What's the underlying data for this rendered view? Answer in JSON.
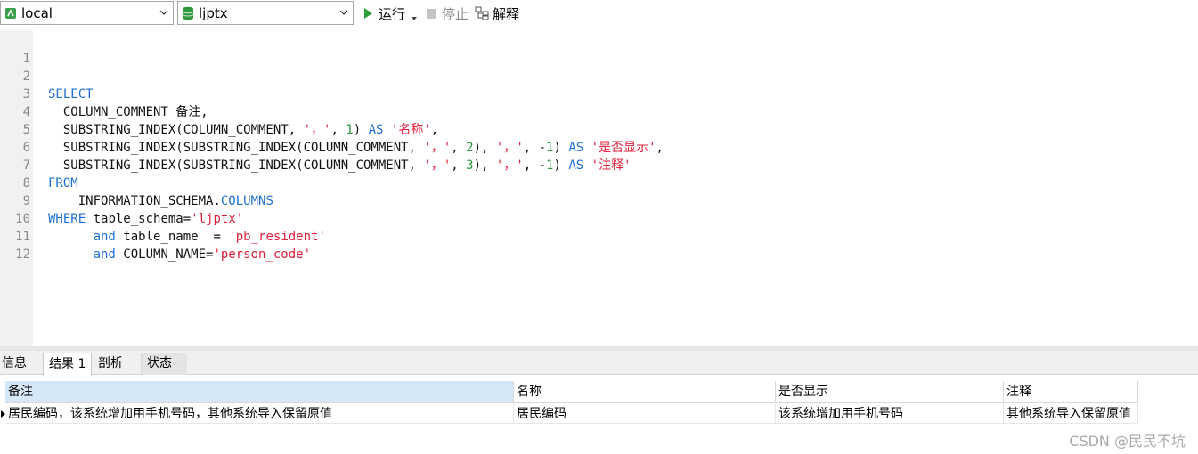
{
  "toolbar": {
    "connection": "local",
    "database": "ljptx",
    "run_label": "运行",
    "stop_label": "停止",
    "explain_label": "解释"
  },
  "editor": {
    "line_numbers": [
      "1",
      "2",
      "3",
      "4",
      "5",
      "6",
      "7",
      "8",
      "9",
      "10",
      "11",
      "12"
    ]
  },
  "result_tabs": [
    "信息",
    "结果 1",
    "剖析",
    "状态"
  ],
  "grid": {
    "columns": [
      "备注",
      "名称",
      "是否显示",
      "注释"
    ],
    "rows": [
      [
        "居民编码，该系统增加用手机号码，其他系统导入保留原值",
        "居民编码",
        "该系统增加用手机号码",
        "其他系统导入保留原值"
      ]
    ]
  },
  "watermark": "CSDN @民民不坑",
  "colors": {
    "keyword": "#1e6fd4",
    "string": "#e0203a",
    "number": "#2b9a3e"
  }
}
